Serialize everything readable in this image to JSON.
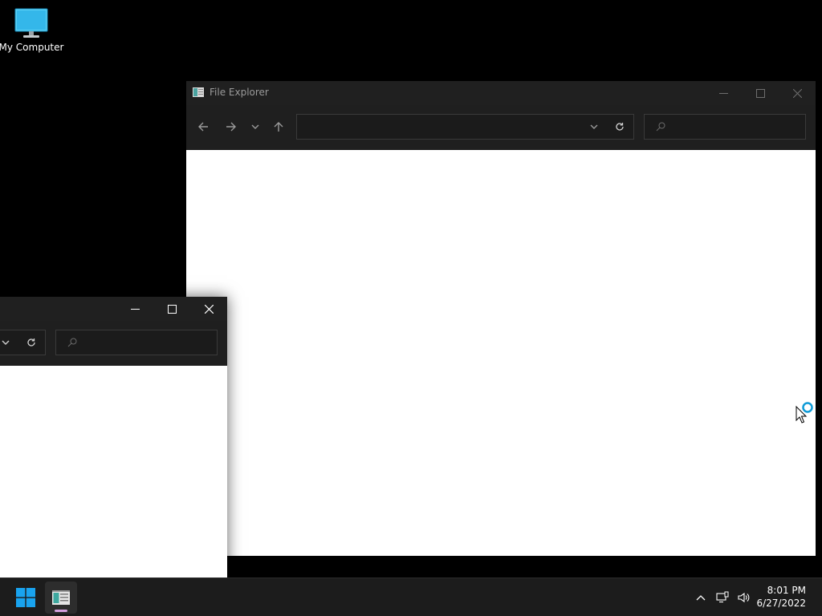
{
  "desktop": {
    "icons": [
      {
        "label": "My Computer",
        "icon": "monitor-icon"
      }
    ]
  },
  "main_window": {
    "title": "File Explorer",
    "icon": "file-explorer-icon",
    "controls": {
      "minimize": "minimize-icon",
      "maximize": "maximize-icon",
      "close": "close-icon"
    },
    "nav": {
      "back": "arrow-left-icon",
      "forward": "arrow-right-icon",
      "recent": "chevron-down-icon",
      "up": "arrow-up-icon"
    },
    "address": {
      "value": "",
      "placeholder": ""
    },
    "search": {
      "value": "",
      "placeholder": ""
    }
  },
  "second_window": {
    "controls": {
      "minimize": "minimize-icon",
      "maximize": "maximize-icon",
      "close": "close-icon"
    },
    "search": {
      "value": "",
      "placeholder": ""
    }
  },
  "taskbar": {
    "start_icon": "windows-logo-icon",
    "apps": [
      {
        "name": "file-explorer-icon",
        "active": true
      }
    ],
    "tray": [
      "chevron-up-icon",
      "network-icon",
      "volume-icon"
    ],
    "clock": {
      "time": "8:01 PM",
      "date": "6/27/2022"
    }
  },
  "colors": {
    "desktop_bg": "#000000",
    "titlebar": "#202020",
    "toolbar": "#1f1f1f",
    "content": "#ffffff",
    "taskbar": "#1c1c1c",
    "accent": "#0f9bd7",
    "indicator": "#d5a1e0"
  }
}
